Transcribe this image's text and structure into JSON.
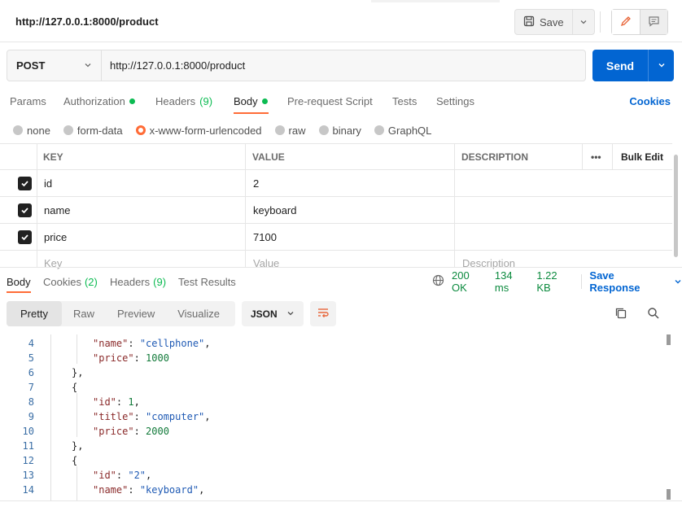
{
  "request": {
    "title": "http://127.0.0.1:8000/product",
    "save_label": "Save",
    "method": "POST",
    "url": "http://127.0.0.1:8000/product",
    "send_label": "Send"
  },
  "request_tabs": [
    {
      "label": "Params"
    },
    {
      "label": "Authorization",
      "dot": true
    },
    {
      "label": "Headers",
      "count": "(9)"
    },
    {
      "label": "Body",
      "dot": true,
      "active": true
    },
    {
      "label": "Pre-request Script"
    },
    {
      "label": "Tests"
    },
    {
      "label": "Settings"
    }
  ],
  "cookies_label": "Cookies",
  "body_types": [
    {
      "label": "none"
    },
    {
      "label": "form-data"
    },
    {
      "label": "x-www-form-urlencoded",
      "selected": true
    },
    {
      "label": "raw"
    },
    {
      "label": "binary"
    },
    {
      "label": "GraphQL"
    }
  ],
  "params_table": {
    "headers": {
      "key": "KEY",
      "value": "VALUE",
      "description": "DESCRIPTION",
      "more": "•••",
      "bulk_edit": "Bulk Edit"
    },
    "rows": [
      {
        "key": "id",
        "value": "2",
        "checked": true
      },
      {
        "key": "name",
        "value": "keyboard",
        "checked": true
      },
      {
        "key": "price",
        "value": "7100",
        "checked": true
      }
    ],
    "placeholder": {
      "key": "Key",
      "value": "Value",
      "description": "Description"
    }
  },
  "response_tabs": [
    {
      "label": "Body",
      "active": true
    },
    {
      "label": "Cookies",
      "count": "(2)"
    },
    {
      "label": "Headers",
      "count": "(9)"
    },
    {
      "label": "Test Results"
    }
  ],
  "response_status": {
    "status": "200 OK",
    "time": "134 ms",
    "size": "1.22 KB",
    "save_response": "Save Response"
  },
  "view_options": [
    {
      "label": "Pretty",
      "active": true
    },
    {
      "label": "Raw"
    },
    {
      "label": "Preview"
    },
    {
      "label": "Visualize"
    }
  ],
  "format": "JSON",
  "code_lines": [
    {
      "n": "4",
      "indent": 2,
      "key": "name",
      "val": "\"cellphone\"",
      "vtype": "str",
      "comma": true
    },
    {
      "n": "5",
      "indent": 2,
      "key": "price",
      "val": "1000",
      "vtype": "num",
      "comma": false
    },
    {
      "n": "6",
      "indent": 1,
      "text": "},"
    },
    {
      "n": "7",
      "indent": 1,
      "text": "{"
    },
    {
      "n": "8",
      "indent": 2,
      "key": "id",
      "val": "1",
      "vtype": "num",
      "comma": true
    },
    {
      "n": "9",
      "indent": 2,
      "key": "title",
      "val": "\"computer\"",
      "vtype": "str",
      "comma": true
    },
    {
      "n": "10",
      "indent": 2,
      "key": "price",
      "val": "2000",
      "vtype": "num",
      "comma": false
    },
    {
      "n": "11",
      "indent": 1,
      "text": "},"
    },
    {
      "n": "12",
      "indent": 1,
      "text": "{"
    },
    {
      "n": "13",
      "indent": 2,
      "key": "id",
      "val": "\"2\"",
      "vtype": "str",
      "comma": true
    },
    {
      "n": "14",
      "indent": 2,
      "key": "name",
      "val": "\"keyboard\"",
      "vtype": "str",
      "comma": true
    }
  ],
  "colors": {
    "accent": "#ff6c37",
    "primary": "#0265d2",
    "success": "#0cbb52"
  },
  "icons": [
    "save-icon",
    "chevron-down-icon",
    "pencil-icon",
    "comment-icon",
    "globe-icon",
    "wrap-lines-icon",
    "copy-icon",
    "search-icon",
    "checkmark-icon"
  ]
}
